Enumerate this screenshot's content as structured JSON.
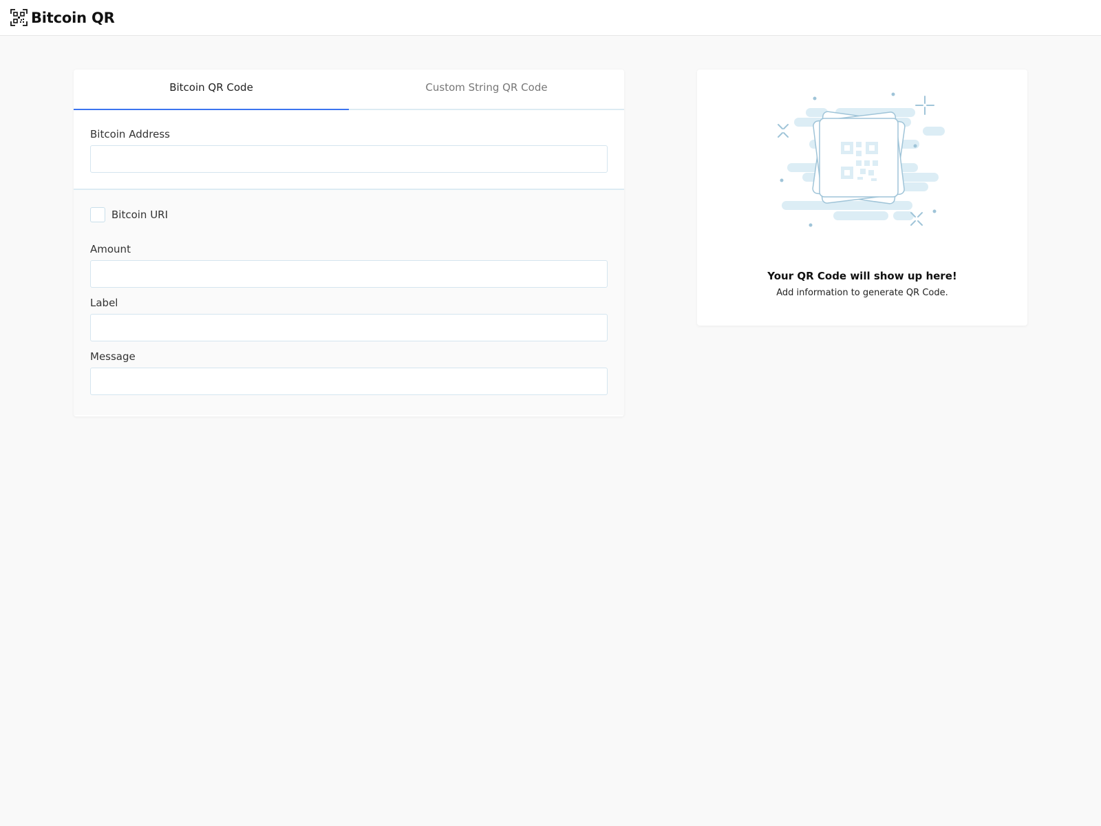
{
  "header": {
    "title": "Bitcoin QR",
    "logo_icon": "qr-scan-icon"
  },
  "tabs": [
    {
      "label": "Bitcoin QR Code",
      "active": true
    },
    {
      "label": "Custom String QR Code",
      "active": false
    }
  ],
  "form": {
    "address": {
      "label": "Bitcoin Address",
      "value": "",
      "placeholder": ""
    },
    "uri_checkbox": {
      "label": "Bitcoin URI",
      "checked": false
    },
    "amount": {
      "label": "Amount",
      "value": "",
      "placeholder": ""
    },
    "label_field": {
      "label": "Label",
      "value": "",
      "placeholder": ""
    },
    "message": {
      "label": "Message",
      "value": "",
      "placeholder": ""
    }
  },
  "preview": {
    "title": "Your QR Code will show up here!",
    "subtitle": "Add information to generate QR Code.",
    "illustration_icon": "qr-placeholder-icon"
  },
  "colors": {
    "accent": "#3b74f0",
    "border": "#d4e5ef",
    "illustration": "#dcedf5",
    "illustration_stroke": "#9fc4d8",
    "background": "#f9f9f9"
  }
}
